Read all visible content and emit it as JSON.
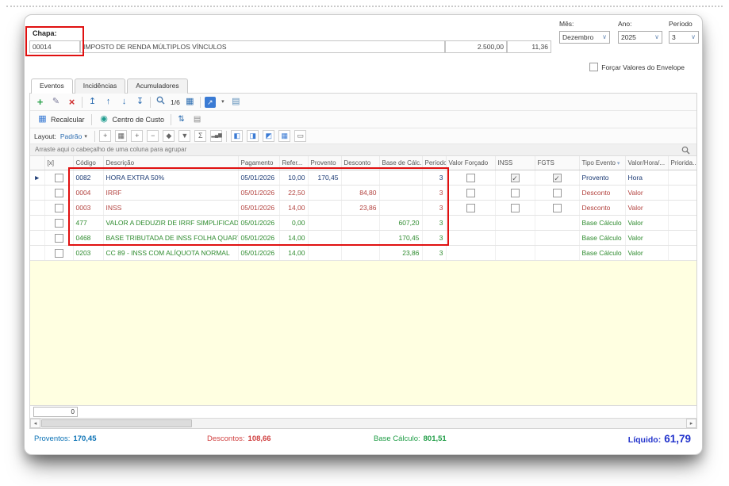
{
  "header": {
    "chapa_label": "Chapa:",
    "chapa_value": "00014",
    "employee_name": "IMPOSTO DE RENDA MÚLTIPLOS VÍNCULOS",
    "value1": "2.500,00",
    "value2": "11,36",
    "mes_label": "Mês:",
    "mes_value": "Dezembro",
    "ano_label": "Ano:",
    "ano_value": "2025",
    "periodo_label": "Período",
    "periodo_value": "3",
    "forcar_label": "Forçar Valores do Envelope"
  },
  "tabs": [
    {
      "label": "Eventos",
      "active": true
    },
    {
      "label": "Incidências",
      "active": false
    },
    {
      "label": "Acumuladores",
      "active": false
    }
  ],
  "toolbar": {
    "pager": "1/6",
    "recalcular_label": "Recalcular",
    "centro_custo_label": "Centro de Custo",
    "layout_label": "Layout:",
    "layout_value": "Padrão"
  },
  "grid": {
    "group_hint": "Arraste aqui o cabeçalho de uma coluna para agrupar",
    "record_count": "0",
    "columns": [
      {
        "id": "check",
        "label": "[x]"
      },
      {
        "id": "codigo",
        "label": "Código"
      },
      {
        "id": "descricao",
        "label": "Descrição"
      },
      {
        "id": "pagamento",
        "label": "Pagamento"
      },
      {
        "id": "refer",
        "label": "Refer..."
      },
      {
        "id": "provento",
        "label": "Provento"
      },
      {
        "id": "desconto",
        "label": "Desconto"
      },
      {
        "id": "base",
        "label": "Base de Cálc."
      },
      {
        "id": "periodo",
        "label": "Período"
      },
      {
        "id": "valor_forcado",
        "label": "Valor Forçado"
      },
      {
        "id": "inss",
        "label": "INSS"
      },
      {
        "id": "fgts",
        "label": "FGTS"
      },
      {
        "id": "tipo_evento",
        "label": "Tipo Evento",
        "filter": true
      },
      {
        "id": "valor_hora",
        "label": "Valor/Hora/..."
      },
      {
        "id": "prioridade",
        "label": "Priorida..."
      }
    ],
    "rows": [
      {
        "codigo": "0082",
        "descricao": "HORA EXTRA 50%",
        "pagamento": "05/01/2026",
        "refer": "10,00",
        "provento": "170,45",
        "desconto": "",
        "base": "",
        "periodo": "3",
        "checks": {
          "valor_forcado": false,
          "inss": true,
          "fgts": true
        },
        "tipo_evento": "Provento",
        "valor_hora": "Hora",
        "kind": "provento",
        "selected": true
      },
      {
        "codigo": "0004",
        "descricao": "IRRF",
        "pagamento": "05/01/2026",
        "refer": "22,50",
        "provento": "",
        "desconto": "84,80",
        "base": "",
        "periodo": "3",
        "checks": {
          "valor_forcado": false,
          "inss": false,
          "fgts": false
        },
        "tipo_evento": "Desconto",
        "valor_hora": "Valor",
        "kind": "desconto",
        "selected": false
      },
      {
        "codigo": "0003",
        "descricao": "INSS",
        "pagamento": "05/01/2026",
        "refer": "14,00",
        "provento": "",
        "desconto": "23,86",
        "base": "",
        "periodo": "3",
        "checks": {
          "valor_forcado": false,
          "inss": false,
          "fgts": false
        },
        "tipo_evento": "Desconto",
        "valor_hora": "Valor",
        "kind": "desconto",
        "selected": false
      },
      {
        "codigo": "477",
        "descricao": "VALOR A DEDUZIR DE IRRF SIMPLIFICADO FOLHA",
        "pagamento": "05/01/2026",
        "refer": "0,00",
        "provento": "",
        "desconto": "",
        "base": "607,20",
        "periodo": "3",
        "checks": null,
        "tipo_evento": "Base Cálculo",
        "valor_hora": "Valor",
        "kind": "base",
        "selected": false
      },
      {
        "codigo": "0468",
        "descricao": "BASE TRIBUTADA DE INSS FOLHA QUARTA FAIXA",
        "pagamento": "05/01/2026",
        "refer": "14,00",
        "provento": "",
        "desconto": "",
        "base": "170,45",
        "periodo": "3",
        "checks": null,
        "tipo_evento": "Base Cálculo",
        "valor_hora": "Valor",
        "kind": "base",
        "selected": false
      },
      {
        "codigo": "0203",
        "descricao": "CC 89 - INSS COM ALÍQUOTA NORMAL",
        "pagamento": "05/01/2026",
        "refer": "14,00",
        "provento": "",
        "desconto": "",
        "base": "23,86",
        "periodo": "3",
        "checks": null,
        "tipo_evento": "Base Cálculo",
        "valor_hora": "Valor",
        "kind": "base",
        "selected": false
      }
    ]
  },
  "footer": {
    "proventos_label": "Proventos:",
    "proventos_value": "170,45",
    "descontos_label": "Descontos:",
    "descontos_value": "108,66",
    "base_label": "Base Cálculo:",
    "base_value": "801,51",
    "liquido_label": "Líquido:",
    "liquido_value": "61,79"
  },
  "icons": {
    "add": "+",
    "edit": "✎",
    "delete": "×",
    "first": "↥",
    "prev": "↑",
    "next": "↓",
    "last": "↧",
    "grid_view": "▦",
    "export": "↗",
    "caret_down": "▾",
    "report": "▤",
    "recalc": "▦",
    "centro": "◉",
    "sort": "⇅",
    "summary_sm": "▤",
    "select_caret": "∨",
    "tool_plus": "+",
    "tool_grid": "▦",
    "tool_minus": "−",
    "tool_pin": "◆",
    "tool_filter": "▼",
    "tool_sigma": "Σ",
    "tool_chart": "▂▄▆",
    "panel_left": "◧",
    "panel_right": "◨",
    "panel_top": "◩",
    "panel_grid": "▦",
    "panel_plain": "▭",
    "row_marker": "►",
    "check": "✓",
    "arrow_left": "◂",
    "arrow_right": "▸"
  },
  "colors": {
    "provento_row": "#1B3A74",
    "desconto_row": "#B3433F",
    "base_row": "#2E8B2E",
    "footer_proventos": "#0B72B5",
    "footer_descontos": "#D04040",
    "footer_base": "#1F9D46",
    "footer_liquido": "#2233CC",
    "annotation_red": "#E01010",
    "accent_blue": "#2B6CB0",
    "empty_area_yellow": "#FFFFE1"
  }
}
